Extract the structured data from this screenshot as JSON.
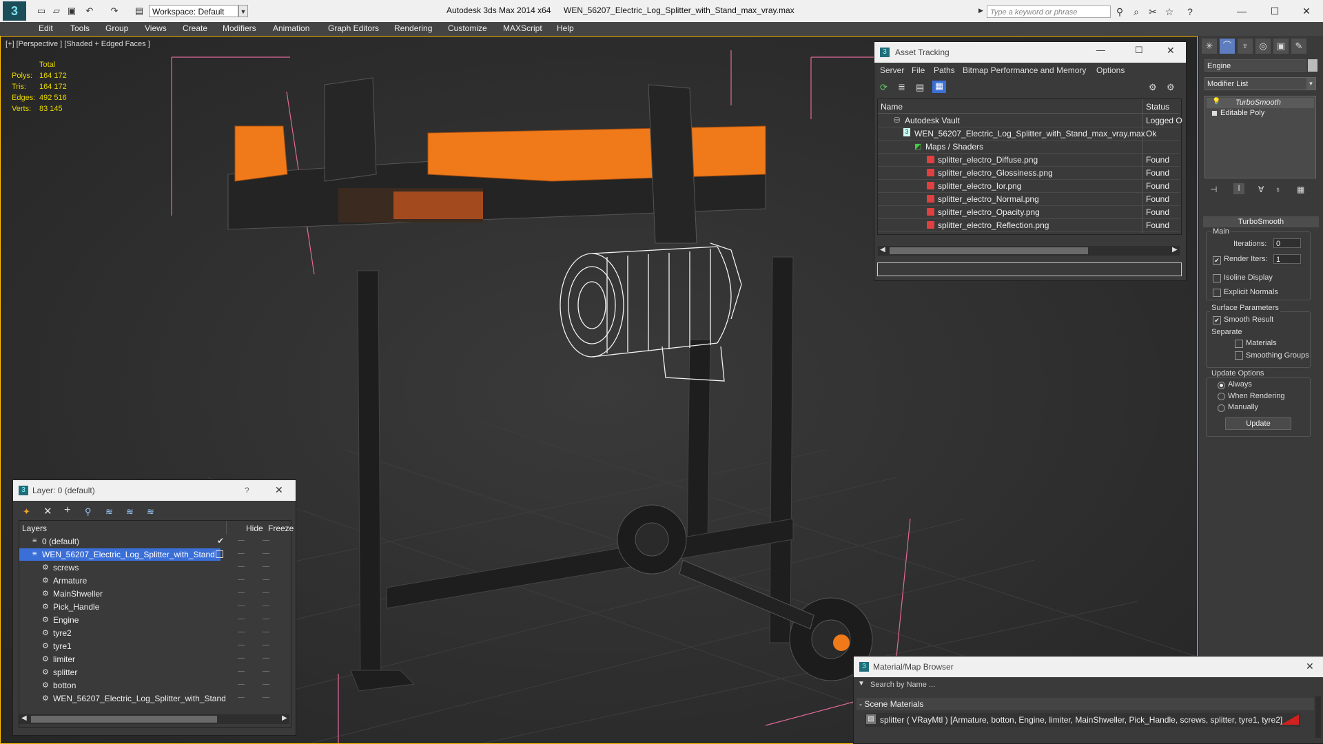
{
  "titlebar": {
    "logo": "3",
    "workspace": "Workspace: Default",
    "app_title": "Autodesk 3ds Max  2014 x64",
    "file_title": "WEN_56207_Electric_Log_Splitter_with_Stand_max_vray.max",
    "search_placeholder": "Type a keyword or phrase",
    "icons": [
      "new-file-icon",
      "open-file-icon",
      "save-icon",
      "undo-icon",
      "redo-icon",
      "project-icon",
      "binoculars-icon",
      "search-tool-icon",
      "tools-icon",
      "star-icon",
      "help-icon",
      "minimize-icon",
      "maximize-icon",
      "close-icon"
    ]
  },
  "menubar": [
    "Edit",
    "Tools",
    "Group",
    "Views",
    "Create",
    "Modifiers",
    "Animation",
    "Graph Editors",
    "Rendering",
    "Customize",
    "MAXScript",
    "Help"
  ],
  "viewport": {
    "label": "[+] [Perspective ] [Shaded + Edged Faces ]",
    "stats": {
      "header": "Total",
      "rows": [
        {
          "label": "Polys:",
          "value": "164 172"
        },
        {
          "label": "Tris:",
          "value": "164 172"
        },
        {
          "label": "Edges:",
          "value": "492 516"
        },
        {
          "label": "Verts:",
          "value": "83 145"
        }
      ]
    }
  },
  "command_panel": {
    "object_name": "Engine",
    "modifier_list": "Modifier List",
    "stack": [
      "TurboSmooth",
      "Editable Poly"
    ],
    "rollout_title": "TurboSmooth",
    "main_label": "Main",
    "iterations_label": "Iterations:",
    "iterations_value": "0",
    "render_iters_label": "Render Iters:",
    "render_iters_value": "1",
    "isoline": "Isoline Display",
    "explicit": "Explicit Normals",
    "surface_params": "Surface Parameters",
    "smooth_result": "Smooth Result",
    "separate": "Separate",
    "materials": "Materials",
    "smoothing_groups": "Smoothing Groups",
    "update_options": "Update Options",
    "always": "Always",
    "when_rendering": "When Rendering",
    "manually": "Manually",
    "update_button": "Update"
  },
  "asset_tracking": {
    "title": "Asset Tracking",
    "menu": [
      "Server",
      "File",
      "Paths",
      "Bitmap Performance and Memory",
      "Options"
    ],
    "col_name": "Name",
    "col_status": "Status",
    "rows": [
      {
        "name": "Autodesk Vault",
        "status": "Logged O"
      },
      {
        "name": "WEN_56207_Electric_Log_Splitter_with_Stand_max_vray.max",
        "status": "Ok"
      },
      {
        "name": "Maps / Shaders",
        "status": ""
      },
      {
        "name": "splitter_electro_Diffuse.png",
        "status": "Found"
      },
      {
        "name": "splitter_electro_Glossiness.png",
        "status": "Found"
      },
      {
        "name": "splitter_electro_Ior.png",
        "status": "Found"
      },
      {
        "name": "splitter_electro_Normal.png",
        "status": "Found"
      },
      {
        "name": "splitter_electro_Opacity.png",
        "status": "Found"
      },
      {
        "name": "splitter_electro_Reflection.png",
        "status": "Found"
      }
    ]
  },
  "layer_dialog": {
    "title": "Layer: 0 (default)",
    "help": "?",
    "col_layers": "Layers",
    "col_hide": "Hide",
    "col_freeze": "Freeze",
    "rows": [
      {
        "name": "0 (default)"
      },
      {
        "name": "WEN_56207_Electric_Log_Splitter_with_Stand"
      },
      {
        "name": "screws"
      },
      {
        "name": "Armature"
      },
      {
        "name": "MainShweller"
      },
      {
        "name": "Pick_Handle"
      },
      {
        "name": "Engine"
      },
      {
        "name": "tyre2"
      },
      {
        "name": "tyre1"
      },
      {
        "name": "limiter"
      },
      {
        "name": "splitter"
      },
      {
        "name": "botton"
      },
      {
        "name": "WEN_56207_Electric_Log_Splitter_with_Stand"
      }
    ]
  },
  "material_browser": {
    "title": "Material/Map Browser",
    "search_placeholder": "Search by Name ...",
    "section": "- Scene Materials",
    "material": "splitter  ( VRayMtl )  [Armature, botton, Engine, limiter, MainShweller, Pick_Handle, screws, splitter, tyre1, tyre2]"
  },
  "colors": {
    "accent_orange": "#f07a1a",
    "viewport_border": "#ffbf00",
    "selection_blue": "#3b6fd8",
    "stats_yellow": "#e8d800"
  }
}
